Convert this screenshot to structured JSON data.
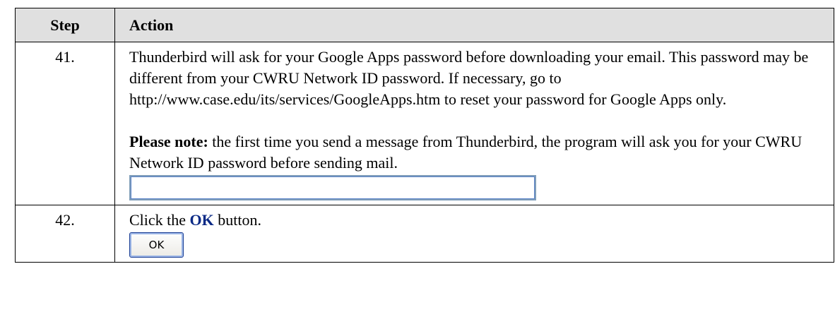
{
  "table": {
    "headers": {
      "step": "Step",
      "action": "Action"
    },
    "rows": [
      {
        "number": "41.",
        "para1": "Thunderbird will ask for your Google Apps password before downloading your email.  This password may be different from your CWRU Network ID password.  If necessary, go to http://www.case.edu/its/services/GoogleApps.htm to reset your password for Google Apps only.",
        "note_label": "Please note:",
        "note_text": " the first time you send a message from Thunderbird, the program will ask you for your CWRU Network ID password before sending mail.",
        "password_field": {
          "value": ""
        }
      },
      {
        "number": "42.",
        "text_before": "Click the ",
        "emphasis": "OK",
        "text_after": " button.",
        "button_label": "OK"
      }
    ]
  }
}
